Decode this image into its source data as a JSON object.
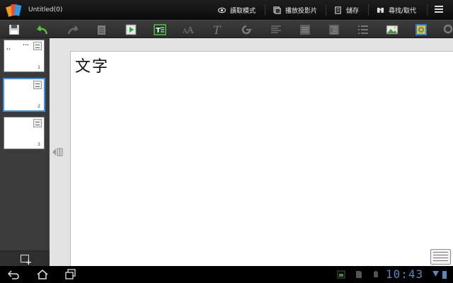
{
  "app": {
    "title": "Untitled(0)",
    "logo_icon": "presentation-logo-icon"
  },
  "actions": [
    {
      "id": "read-mode",
      "label": "讀取模式",
      "icon": "eye-icon"
    },
    {
      "id": "play-slideshow",
      "label": "播放投影片",
      "icon": "slideshow-icon"
    },
    {
      "id": "save",
      "label": "儲存",
      "icon": "document-save-icon"
    },
    {
      "id": "find-replace",
      "label": "尋找/取代",
      "icon": "binoculars-icon"
    }
  ],
  "toolbar": [
    "save-icon",
    "undo-icon",
    "redo-icon",
    "clipboard-icon",
    "play-slide-icon",
    "text-box-icon",
    "font-size-icon",
    "italic-text-icon",
    "rotate-shape-icon",
    "align-icon",
    "bullet-list-icon",
    "indent-list-icon",
    "numbered-list-icon",
    "insert-image-icon",
    "picture-edit-icon",
    "search-icon"
  ],
  "slides": [
    {
      "number": "1",
      "preview_text_left": "••",
      "preview_text_right": "•••"
    },
    {
      "number": "2"
    },
    {
      "number": "3"
    }
  ],
  "current_slide": {
    "text": "文字"
  },
  "system": {
    "clock": "10:43"
  },
  "colors": {
    "selection": "#3d8ee6",
    "clock": "#5a87b8",
    "toolbar_bg": "#333333",
    "panel_bg": "#3b3b3b"
  }
}
